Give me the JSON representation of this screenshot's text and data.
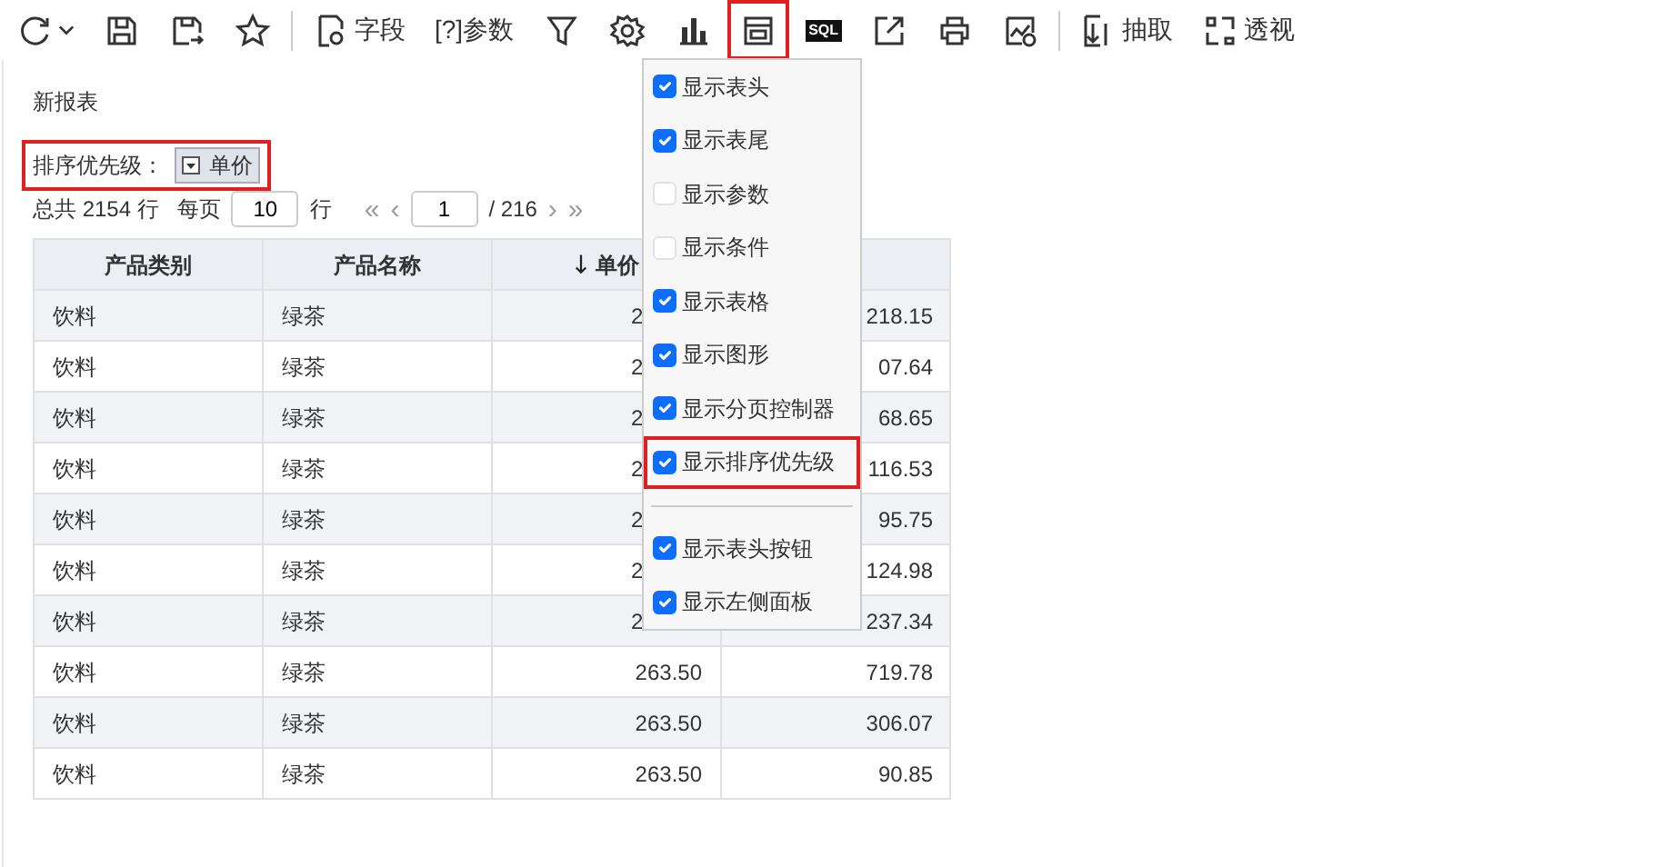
{
  "toolbar": [
    {
      "selected": false
    },
    {
      "selected": false
    },
    {
      "selected": false
    },
    {
      "selected": false
    },
    {
      "label": "字段",
      "selected": false
    },
    {
      "label": "[?]参数",
      "selected": false
    },
    {
      "selected": false
    },
    {
      "selected": false
    },
    {
      "selected": false
    },
    {
      "selected": true
    },
    {
      "label": "SQL",
      "kind": "badge",
      "selected": false
    },
    {
      "selected": false
    },
    {
      "selected": false
    },
    {
      "selected": false
    },
    {
      "label": "抽取",
      "selected": false
    },
    {
      "label": "透视",
      "selected": false
    }
  ],
  "report": {
    "title": "新报表",
    "sort_priority": {
      "label": "排序优先级：",
      "value": "单价",
      "highlighted": true
    },
    "pager": {
      "total": "总共 2154 行",
      "per_page_label": "每页",
      "per_page": "10",
      "rows_label": "行",
      "first": "«",
      "prev": "‹",
      "page": "1",
      "pages": "/ 216",
      "next": "›",
      "last": "»"
    },
    "table": {
      "columns": [
        {
          "label": "产品类别",
          "sort_descending": false
        },
        {
          "label": "产品名称",
          "sort_descending": false
        },
        {
          "label": "单价",
          "sort_descending": true
        },
        {
          "sort_descending": false
        }
      ],
      "rows": [
        [
          "饮料",
          "绿茶",
          "2",
          "218.15"
        ],
        [
          "饮料",
          "绿茶",
          "2",
          "07.64"
        ],
        [
          "饮料",
          "绿茶",
          "2",
          "68.65"
        ],
        [
          "饮料",
          "绿茶",
          "2",
          "116.53"
        ],
        [
          "饮料",
          "绿茶",
          "2",
          "95.75"
        ],
        [
          "饮料",
          "绿茶",
          "2",
          "124.98"
        ],
        [
          "饮料",
          "绿茶",
          "2",
          "237.34"
        ],
        [
          "饮料",
          "绿茶",
          "263.50",
          "719.78"
        ],
        [
          "饮料",
          "绿茶",
          "263.50",
          "306.07"
        ],
        [
          "饮料",
          "绿茶",
          "263.50",
          "90.85"
        ]
      ]
    }
  },
  "menu": [
    {
      "kind": "check",
      "label": "显示表头",
      "checked": true,
      "selected": false
    },
    {
      "kind": "check",
      "label": "显示表尾",
      "checked": true,
      "selected": false
    },
    {
      "kind": "check",
      "label": "显示参数",
      "checked": false,
      "selected": false
    },
    {
      "kind": "check",
      "label": "显示条件",
      "checked": false,
      "selected": false
    },
    {
      "kind": "check",
      "label": "显示表格",
      "checked": true,
      "selected": false
    },
    {
      "kind": "check",
      "label": "显示图形",
      "checked": true,
      "selected": false
    },
    {
      "kind": "check",
      "label": "显示分页控制器",
      "checked": true,
      "selected": false
    },
    {
      "kind": "check",
      "label": "显示排序优先级",
      "checked": true,
      "selected": true
    },
    {
      "kind": "divider"
    },
    {
      "kind": "check",
      "label": "显示表头按钮",
      "checked": true,
      "selected": false
    },
    {
      "kind": "check",
      "label": "显示左侧面板",
      "checked": true,
      "selected": false
    }
  ]
}
